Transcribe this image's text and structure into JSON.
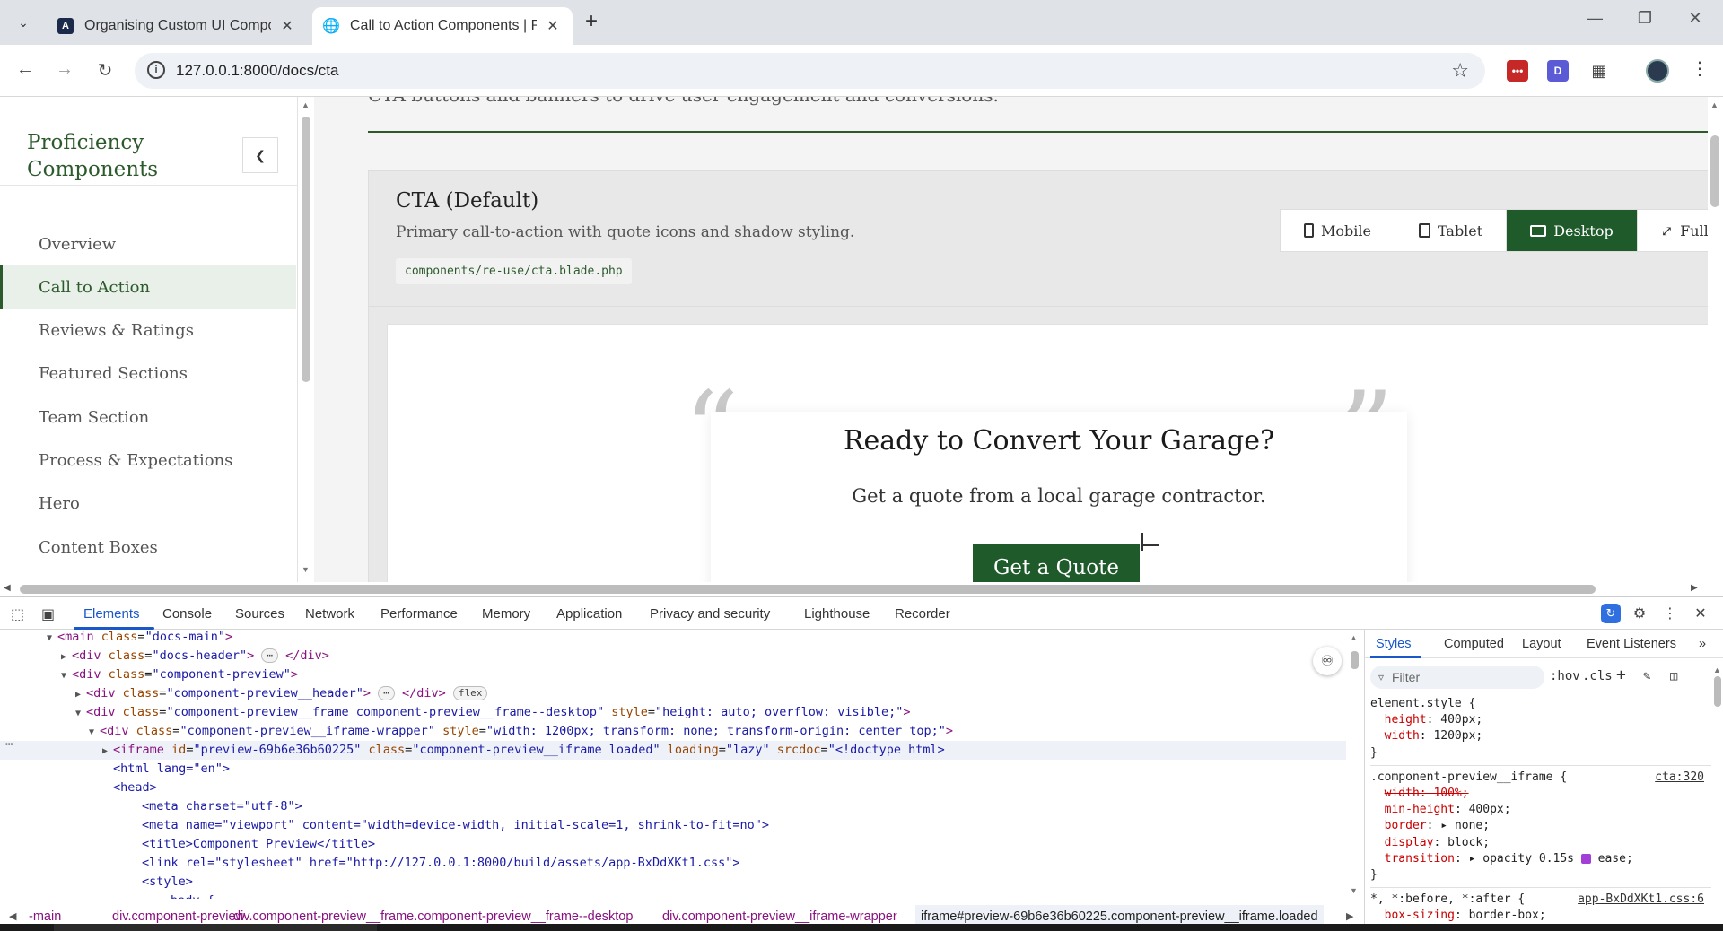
{
  "browser": {
    "tabs": [
      {
        "title": "Organising Custom UI Components",
        "active": false
      },
      {
        "title": "Call to Action Components | Proficiency",
        "active": true
      }
    ],
    "url": "127.0.0.1:8000/docs/cta"
  },
  "sidebar": {
    "brand": "Proficiency Components",
    "items": [
      {
        "label": "Overview"
      },
      {
        "label": "Call to Action"
      },
      {
        "label": "Reviews & Ratings"
      },
      {
        "label": "Featured Sections"
      },
      {
        "label": "Team Section"
      },
      {
        "label": "Process & Expectations"
      },
      {
        "label": "Hero"
      },
      {
        "label": "Content Boxes"
      }
    ],
    "active_index": 1
  },
  "page": {
    "lead": "CTA buttons and banners to drive user engagement and conversions.",
    "component": {
      "title": "CTA (Default)",
      "description": "Primary call-to-action with quote icons and shadow styling.",
      "path": "components/re-use/cta.blade.php",
      "viewports": [
        "Mobile",
        "Tablet",
        "Desktop",
        "Full"
      ],
      "active_viewport": "Desktop"
    },
    "cta": {
      "heading": "Ready to Convert Your Garage?",
      "subheading": "Get a quote from a local garage contractor.",
      "button": "Get a Quote"
    }
  },
  "devtools": {
    "tabs": [
      "Elements",
      "Console",
      "Sources",
      "Network",
      "Performance",
      "Memory",
      "Application",
      "Privacy and security",
      "Lighthouse",
      "Recorder"
    ],
    "active_tab": "Elements",
    "style_tabs": [
      "Styles",
      "Computed",
      "Layout",
      "Event Listeners"
    ],
    "filter_placeholder": "Filter",
    "hov": ":hov",
    "cls": ".cls",
    "breadcrumbs": [
      "-main",
      "div.component-preview",
      "div.component-preview__frame.component-preview__frame--desktop",
      "div.component-preview__iframe-wrapper",
      "iframe#preview-69b6e36b60225.component-preview__iframe.loaded"
    ],
    "badge_flex": "flex",
    "css_sources": [
      "cta:320",
      "app-BxDdXKt1.css:6"
    ]
  },
  "colors": {
    "accent_green": "#1f5a2b",
    "devtools_blue": "#1a57c9"
  }
}
